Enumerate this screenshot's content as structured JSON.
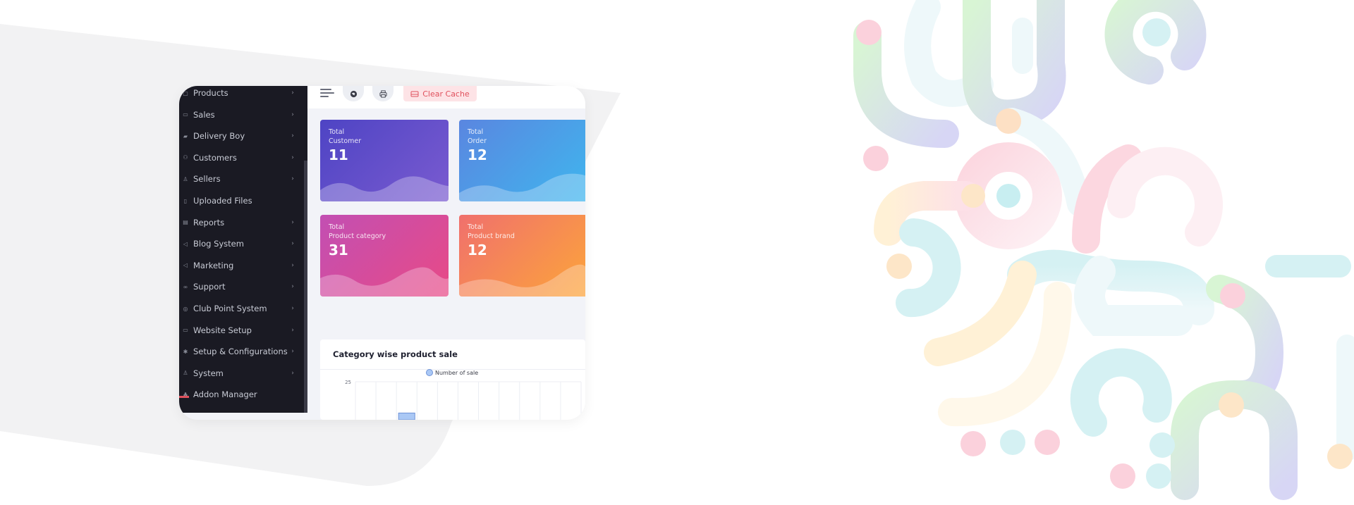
{
  "sidebar": {
    "items": [
      {
        "label": "Products",
        "icon": "box-icon",
        "chevron": true
      },
      {
        "label": "Sales",
        "icon": "money-icon",
        "chevron": true
      },
      {
        "label": "Delivery Boy",
        "icon": "truck-icon",
        "chevron": true
      },
      {
        "label": "Customers",
        "icon": "users-icon",
        "chevron": true
      },
      {
        "label": "Sellers",
        "icon": "user-icon",
        "chevron": true
      },
      {
        "label": "Uploaded Files",
        "icon": "folder-icon",
        "chevron": false
      },
      {
        "label": "Reports",
        "icon": "file-icon",
        "chevron": true
      },
      {
        "label": "Blog System",
        "icon": "bullhorn-icon",
        "chevron": true
      },
      {
        "label": "Marketing",
        "icon": "bullhorn-icon",
        "chevron": true
      },
      {
        "label": "Support",
        "icon": "link-icon",
        "chevron": true
      },
      {
        "label": "Club Point System",
        "icon": "coin-icon",
        "chevron": true
      },
      {
        "label": "Website Setup",
        "icon": "desktop-icon",
        "chevron": true
      },
      {
        "label": "Setup & Configurations",
        "icon": "gear-icon",
        "chevron": true
      },
      {
        "label": "System",
        "icon": "user-icon",
        "chevron": true
      },
      {
        "label": "Addon Manager",
        "icon": "puzzle-icon",
        "chevron": false
      }
    ]
  },
  "topbar": {
    "menu_icon": "hamburger-icon",
    "globe_icon": "globe-icon",
    "print_icon": "printer-icon",
    "clear_cache_label": "Clear Cache"
  },
  "cards": [
    {
      "line1": "Total",
      "line2": "Customer",
      "value": "11",
      "gradient_from": "#4e44c4",
      "gradient_to": "#7a5bd0"
    },
    {
      "line1": "Total",
      "line2": "Order",
      "value": "12",
      "gradient_from": "#5a86e0",
      "gradient_to": "#3fb6ee"
    },
    {
      "line1": "Total",
      "line2": "Product category",
      "value": "31",
      "gradient_from": "#c24fb3",
      "gradient_to": "#e84a86"
    },
    {
      "line1": "Total",
      "line2": "Product brand",
      "value": "12",
      "gradient_from": "#f0706d",
      "gradient_to": "#fca53a"
    }
  ],
  "chart_panel": {
    "title": "Category wise product sale"
  },
  "chart_data": {
    "type": "bar",
    "series": [
      {
        "name": "Number of sale",
        "values": [
          0,
          0,
          3,
          0,
          0,
          0,
          0,
          0,
          0,
          0,
          0
        ]
      }
    ],
    "ylim": [
      0,
      25
    ],
    "y_ticks": [
      "25"
    ],
    "legend_placement": "top",
    "bar_color": "#aac8f5",
    "grid": true
  },
  "colors": {
    "sidebar_bg": "#1a1a23",
    "accent_red": "#e0515d",
    "page_bg": "#f2f3f8"
  }
}
